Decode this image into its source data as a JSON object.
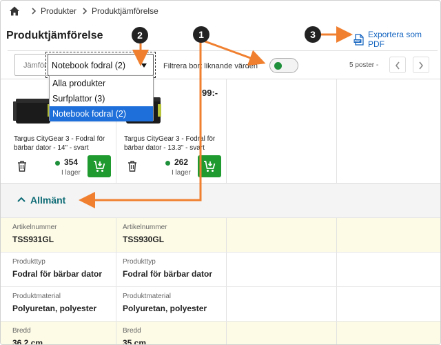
{
  "breadcrumb": {
    "items": [
      "Produkter",
      "Produktjämförelse"
    ]
  },
  "page_title": "Produktjämförelse",
  "export_label": "Exportera som PDF",
  "toolbar": {
    "compare_select_value": "Jämför",
    "category_select_value": "Notebook fodral (2)",
    "filter_label": "Filtrera bort liknande värden",
    "filter_enabled": true,
    "post_count": "5 poster -"
  },
  "dropdown": {
    "options": [
      "Alla produkter",
      "Surfplattor (3)",
      "Notebook fodral (2)"
    ],
    "selected_index": 2
  },
  "products": [
    {
      "name": "Targus CityGear 3 - Fodral för bärbar dator - 14\" - svart",
      "stock": "354",
      "stock_label": "I lager"
    },
    {
      "name": "Targus CityGear 3 - Fodral för bärbar dator - 13.3\" - svart",
      "stock": "262",
      "stock_label": "I lager",
      "price": "99:-"
    }
  ],
  "section": {
    "title": "Allmänt"
  },
  "spec_rows": [
    {
      "label": "Artikelnummer",
      "values": [
        "TSS931GL",
        "TSS930GL"
      ],
      "highlight": true
    },
    {
      "label": "Produkttyp",
      "values": [
        "Fodral för bärbar dator",
        "Fodral för bärbar dator"
      ],
      "highlight": false
    },
    {
      "label": "Produktmaterial",
      "values": [
        "Polyuretan, polyester",
        "Polyuretan, polyester"
      ],
      "highlight": false
    },
    {
      "label": "Bredd",
      "values": [
        "36.2 cm",
        "35 cm"
      ],
      "highlight": true
    }
  ],
  "annotations": [
    "1",
    "2",
    "3"
  ],
  "colors": {
    "accent": "#1565c0",
    "section_title": "#0d6b75",
    "cart_green": "#1e9a2f",
    "stock_dot": "#1e8f3a",
    "annotation_arrow": "#f08030",
    "highlight_row": "#fdfbe6",
    "dropdown_selected": "#1e6fd9"
  },
  "icons": {
    "home": "home-icon",
    "breadcrumb_separator": "chevron-right-icon",
    "export": "pdf-file-icon",
    "pager_prev": "chevron-left-icon",
    "pager_next": "chevron-right-icon",
    "delete": "trash-icon",
    "cart": "add-to-cart-icon",
    "section_toggle": "chevron-up-icon"
  }
}
